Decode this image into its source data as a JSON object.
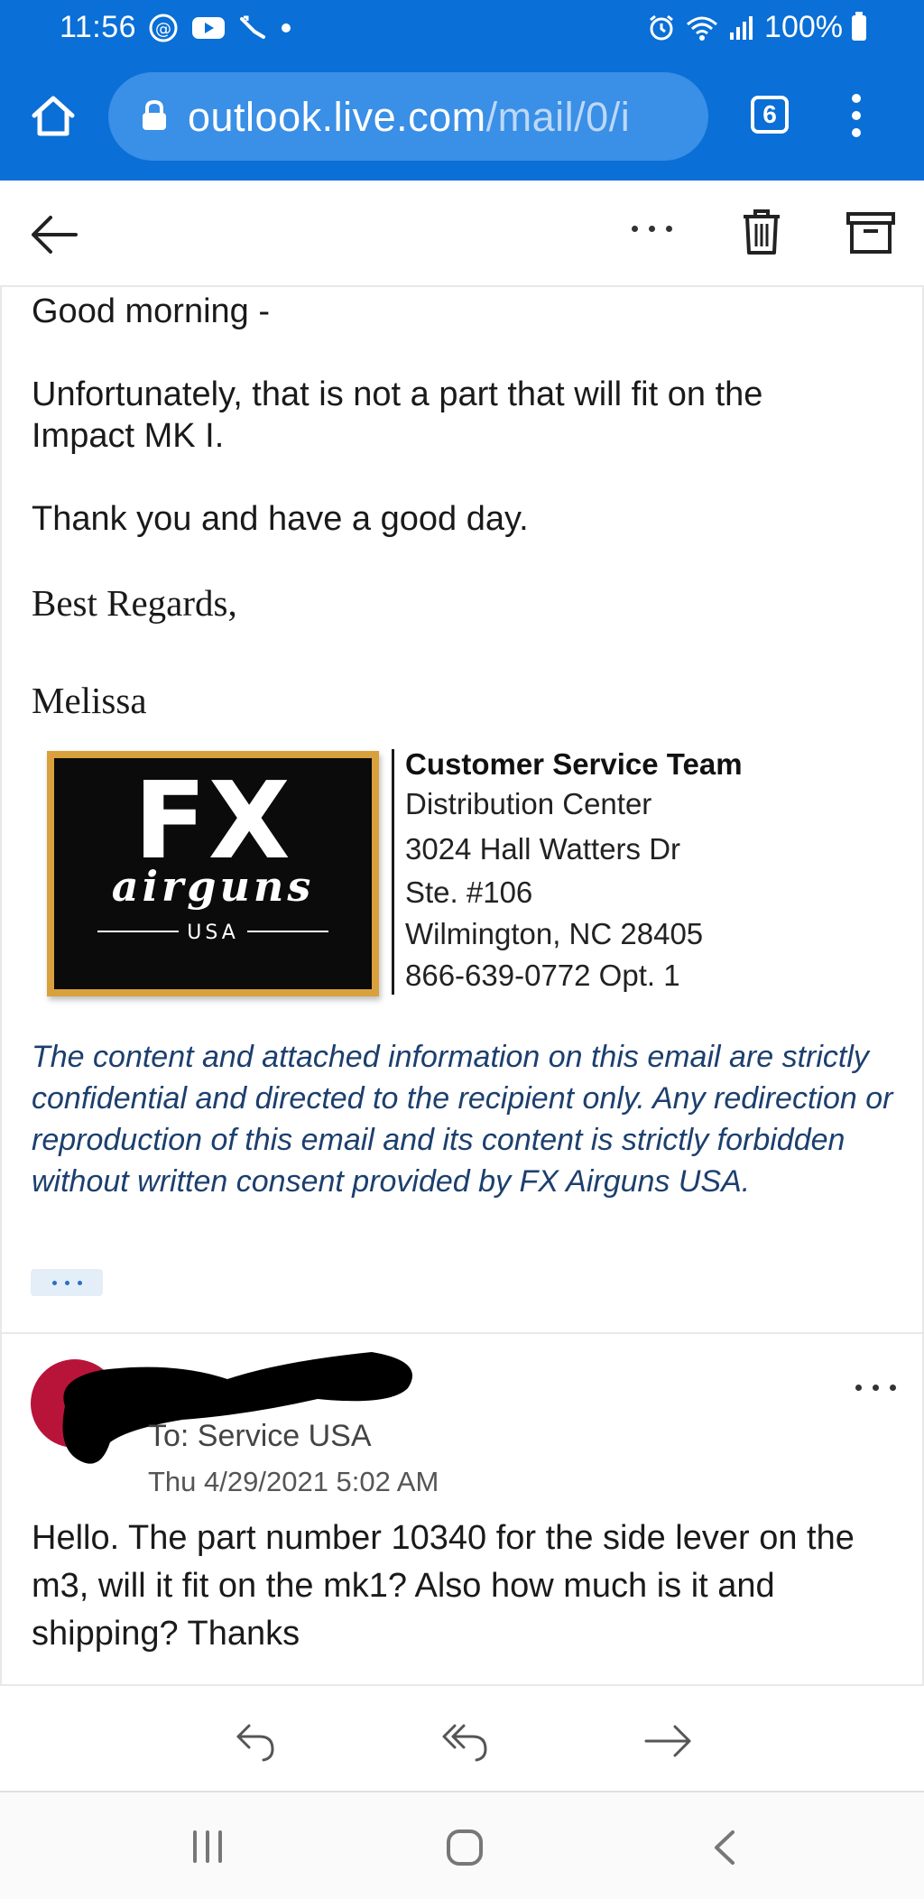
{
  "status_bar": {
    "time": "11:56",
    "battery": "100%"
  },
  "browser": {
    "url_host": "outlook.live.com",
    "url_path": "/mail/0/i",
    "tab_count": "6"
  },
  "email": {
    "greeting": "Good morning -",
    "body_line1": "Unfortunately, that is not a part that will fit on the",
    "body_line2": "Impact MK I.",
    "thanks": "Thank you and have a good day.",
    "closing": "Best Regards,",
    "name": "Melissa",
    "logo": {
      "brand_big": "FX",
      "brand_script": "airguns",
      "brand_sub": "USA"
    },
    "signature": [
      "Customer Service Team",
      "Distribution Center",
      "3024 Hall Watters Dr",
      "Ste. #106",
      "Wilmington, NC 28405",
      "866-639-0772 Opt. 1"
    ],
    "disclaimer": "The content and attached information on this email are strictly confidential and directed to the recipient only. Any redirection or reproduction of this email and its content is strictly forbidden without written consent provided by FX Airguns USA."
  },
  "previous_message": {
    "to": "To: Service USA",
    "date": "Thu 4/29/2021 5:02 AM",
    "body": "Hello. The part number 10340 for the side lever on the m3, will it fit on the mk1? Also how much is it and shipping? Thanks"
  },
  "icons": {
    "home": "home-icon",
    "lock": "lock-icon",
    "tabs": "tabs-icon",
    "menu": "kebab-menu-icon",
    "back": "back-arrow-icon",
    "more": "more-horizontal-icon",
    "delete": "trash-icon",
    "archive": "archive-icon",
    "reply": "reply-icon",
    "reply_all": "reply-all-icon",
    "forward": "forward-icon"
  },
  "colors": {
    "browser_blue": "#0a6fd6",
    "url_pill": "#3a8fe6",
    "disclaimer_text": "#1c3f6e",
    "avatar": "#b8143a",
    "logo_border": "#d9a13d"
  }
}
